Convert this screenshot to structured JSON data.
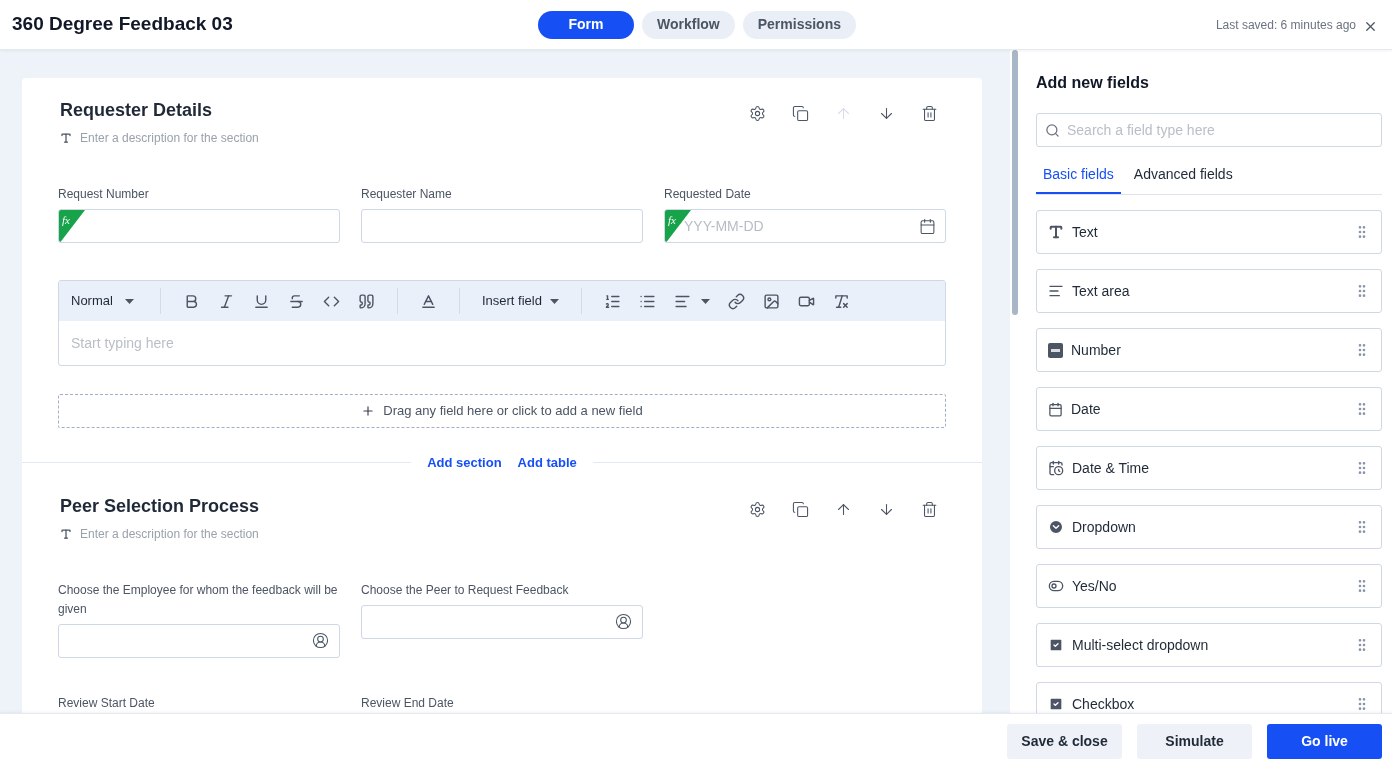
{
  "header": {
    "title": "360 Degree Feedback 03",
    "tabs": [
      {
        "label": "Form",
        "selected": true
      },
      {
        "label": "Workflow",
        "selected": false
      },
      {
        "label": "Permissions",
        "selected": false
      }
    ],
    "last_saved": "Last saved: 6 minutes ago"
  },
  "sections": [
    {
      "title": "Requester Details",
      "description_placeholder": "Enter a description for the section",
      "actions": [
        {
          "kind": "settings",
          "disabled": false
        },
        {
          "kind": "copy",
          "disabled": false
        },
        {
          "kind": "up",
          "disabled": true
        },
        {
          "kind": "down",
          "disabled": false
        },
        {
          "kind": "delete",
          "disabled": false
        }
      ],
      "rows": [
        [
          {
            "label": "Request Number",
            "kind": "formula",
            "badge": "fx"
          },
          {
            "label": "Requester Name",
            "kind": "text"
          },
          {
            "label": "Requested Date",
            "kind": "formula_date",
            "badge": "fx",
            "placeholder": "YYY-MM-DD"
          }
        ]
      ],
      "editor": {
        "style": "Normal",
        "insert": "Insert field",
        "placeholder": "Start typing here"
      },
      "dropzone": "Drag any field here or click to add a new field",
      "links": [
        "Add section",
        "Add table"
      ]
    },
    {
      "title": "Peer Selection Process",
      "description_placeholder": "Enter a description for the section",
      "actions": [
        {
          "kind": "settings",
          "disabled": false
        },
        {
          "kind": "copy",
          "disabled": false
        },
        {
          "kind": "up",
          "disabled": false
        },
        {
          "kind": "down",
          "disabled": false
        },
        {
          "kind": "delete",
          "disabled": false
        }
      ],
      "rows": [
        [
          {
            "label": "Choose the Employee for whom the feedback will be given",
            "kind": "user"
          },
          {
            "label": "Choose the Peer to Request Feedback",
            "kind": "user"
          }
        ],
        [
          {
            "label": "Review Start Date"
          },
          {
            "label": "Review End Date"
          }
        ]
      ]
    }
  ],
  "panel": {
    "title": "Add new fields",
    "search_placeholder": "Search a field type here",
    "tabs": [
      {
        "label": "Basic fields",
        "selected": true
      },
      {
        "label": "Advanced fields",
        "selected": false
      }
    ],
    "fields": [
      {
        "label": "Text",
        "kind": "text"
      },
      {
        "label": "Text area",
        "kind": "textarea"
      },
      {
        "label": "Number",
        "kind": "number"
      },
      {
        "label": "Date",
        "kind": "date"
      },
      {
        "label": "Date & Time",
        "kind": "datetime"
      },
      {
        "label": "Dropdown",
        "kind": "dropdown"
      },
      {
        "label": "Yes/No",
        "kind": "toggle"
      },
      {
        "label": "Multi-select dropdown",
        "kind": "multiselect"
      },
      {
        "label": "Checkbox",
        "kind": "checkbox"
      }
    ]
  },
  "footer": {
    "buttons": [
      {
        "label": "Save & close",
        "kind": "secondary"
      },
      {
        "label": "Simulate",
        "kind": "secondary"
      },
      {
        "label": "Go live",
        "kind": "primary"
      }
    ]
  }
}
